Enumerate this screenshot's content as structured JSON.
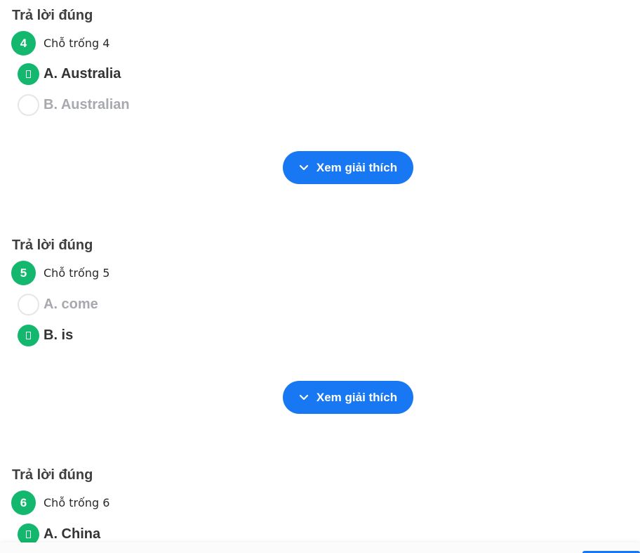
{
  "questions": [
    {
      "result": "Trả lời đúng",
      "number": "4",
      "prompt": "Chỗ trống 4",
      "options": [
        {
          "label": "A. Australia",
          "state": "correct"
        },
        {
          "label": "B. Australian",
          "state": "unselected"
        }
      ],
      "explain_label": "Xem giải thích"
    },
    {
      "result": "Trả lời đúng",
      "number": "5",
      "prompt": "Chỗ trống 5",
      "options": [
        {
          "label": "A. come",
          "state": "unselected"
        },
        {
          "label": "B. is",
          "state": "correct"
        }
      ],
      "explain_label": "Xem giải thích"
    },
    {
      "result": "Trả lời đúng",
      "number": "6",
      "prompt": "Chỗ trống 6",
      "options": [
        {
          "label": "A. China",
          "state": "correct"
        }
      ]
    }
  ],
  "colors": {
    "correct_green": "#14b76e",
    "button_blue": "#1877f2",
    "muted_text": "#a7a9ae"
  },
  "icons": {
    "correct_marker": "check-icon",
    "explain_chevron": "chevron-down-icon"
  }
}
